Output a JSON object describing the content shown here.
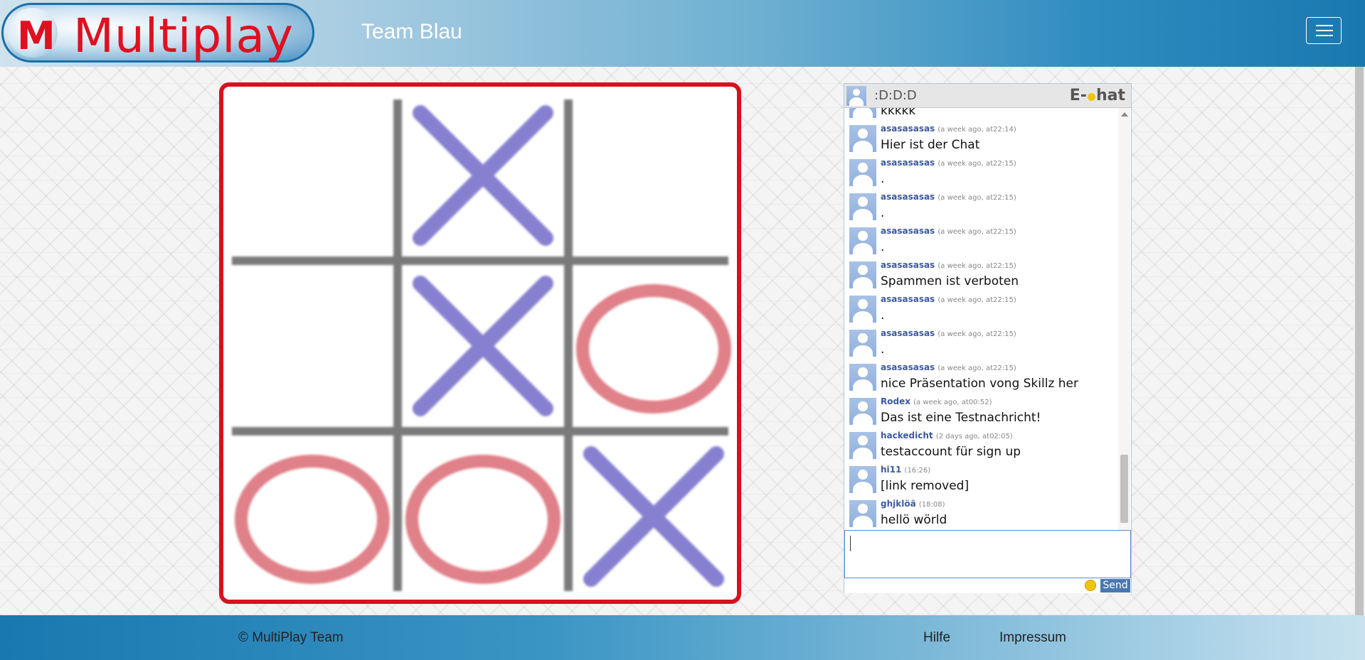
{
  "header": {
    "logo_letter": "M",
    "logo_text": "Multiplay",
    "team_title": "Team Blau"
  },
  "board": {
    "cells": [
      "",
      "X",
      "",
      "",
      "X",
      "O",
      "O",
      "O",
      "X"
    ],
    "x_color": "#8780d0",
    "o_color": "#e08088",
    "border_color": "#d8101f"
  },
  "chat": {
    "current_user": ":D:D:D",
    "brand_left": "E-",
    "brand_right": "hat",
    "messages": [
      {
        "name": "",
        "time": "",
        "text": "kkkkk"
      },
      {
        "name": "asasasasas",
        "time": "(a week ago, at22:14)",
        "text": "Hier ist der Chat"
      },
      {
        "name": "asasasasas",
        "time": "(a week ago, at22:15)",
        "text": "."
      },
      {
        "name": "asasasasas",
        "time": "(a week ago, at22:15)",
        "text": "."
      },
      {
        "name": "asasasasas",
        "time": "(a week ago, at22:15)",
        "text": "."
      },
      {
        "name": "asasasasas",
        "time": "(a week ago, at22:15)",
        "text": "Spammen ist verboten"
      },
      {
        "name": "asasasasas",
        "time": "(a week ago, at22:15)",
        "text": "."
      },
      {
        "name": "asasasasas",
        "time": "(a week ago, at22:15)",
        "text": "."
      },
      {
        "name": "asasasasas",
        "time": "(a week ago, at22:15)",
        "text": "nice Präsentation vong Skillz her"
      },
      {
        "name": "Rodex",
        "time": "(a week ago, at00:52)",
        "text": "Das ist eine Testnachricht!"
      },
      {
        "name": "hackedicht",
        "time": "(2 days ago, at02:05)",
        "text": "testaccount für sign up"
      },
      {
        "name": "hi11",
        "time": "(16:26)",
        "text": "[link removed]"
      },
      {
        "name": "ghjklöä",
        "time": "(18:08)",
        "text": "hellö wörld"
      }
    ],
    "input_value": "",
    "send_label": "Send"
  },
  "footer": {
    "copyright": "© MultiPlay Team",
    "links": [
      "Hilfe",
      "Impressum"
    ]
  }
}
